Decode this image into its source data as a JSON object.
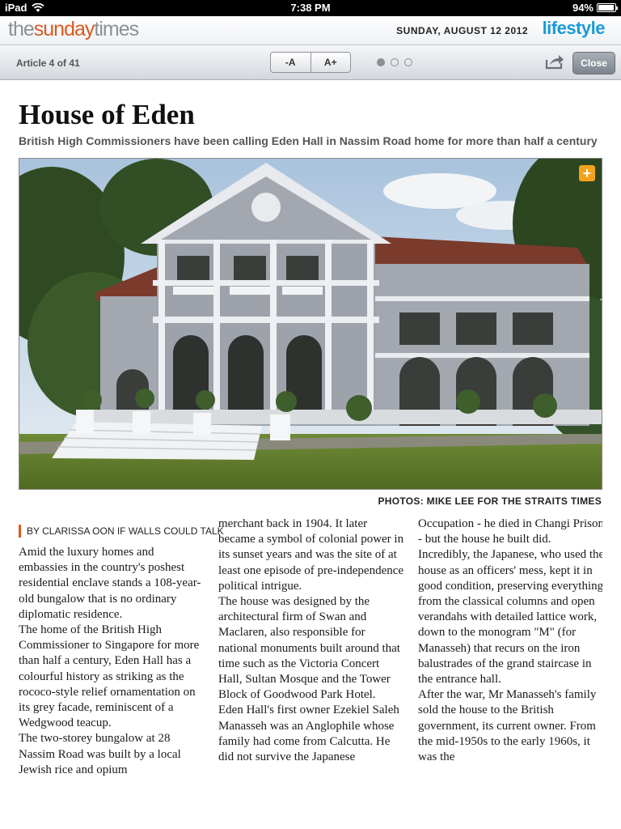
{
  "status_bar": {
    "device": "iPad",
    "time": "7:38 PM",
    "battery": "94%",
    "battery_level": 0.94
  },
  "masthead": {
    "logo_the": "the",
    "logo_sunday": "sunday",
    "logo_times": "times",
    "date": "SUNDAY, AUGUST 12 2012",
    "section": "lifestyle"
  },
  "toolbar": {
    "article_count": "Article 4 of 41",
    "font_decrease": "-A",
    "font_increase": "A+",
    "page_dots": 3,
    "active_dot": 0,
    "close": "Close"
  },
  "article": {
    "headline": "House of Eden",
    "subhead": "British High Commissioners have been calling Eden Hall in Nassim Road home for more than half a century",
    "photo_credit": "PHOTOS: MIKE LEE FOR THE STRAITS TIMES",
    "byline": "BY CLARISSA OON IF WALLS COULD TALK",
    "col1": [
      "Amid the luxury homes and embassies in the country's poshest residential enclave stands a 108-year-old bungalow that is no ordinary diplomatic residence.",
      " The home of the British High Commissioner to Singapore for more than half a century, Eden Hall has a colourful history as striking as the rococo-style relief ornamentation on its grey facade, reminiscent of a Wedgwood teacup.",
      " The two-storey bungalow at 28 Nassim Road was built by a local Jewish rice and opium"
    ],
    "col2": [
      "merchant back in 1904. It later became a symbol of colonial power in its sunset years and was the site of at least one episode of pre-independence political intrigue.",
      " The house was designed by the architectural firm of Swan and Maclaren, also responsible for national monuments built around that time such as the Victoria Concert Hall, Sultan Mosque and the Tower Block of Goodwood Park Hotel.",
      " Eden Hall's first owner Ezekiel Saleh Manasseh was an Anglophile whose family had come from Calcutta. He did not survive the Japanese"
    ],
    "col3": [
      "Occupation - he died in Changi Prison - but the house he built did.",
      " Incredibly, the Japanese, who used the house as an officers' mess, kept it in good condition, preserving everything from the classical columns and open verandahs with detailed lattice work, down to the monogram \"M\" (for Manasseh) that recurs on the iron balustrades of the grand staircase in the entrance hall.",
      " After the war, Mr Manasseh's family sold the house to the British government, its current owner. From the mid-1950s to the early 1960s, it was the"
    ]
  },
  "colors": {
    "accent_orange": "#e05a1a",
    "section_blue": "#1a9ad6",
    "expand_badge": "#f2a21c"
  },
  "icons": {
    "wifi": "wifi-icon",
    "share": "share-icon",
    "expand": "plus-icon"
  }
}
